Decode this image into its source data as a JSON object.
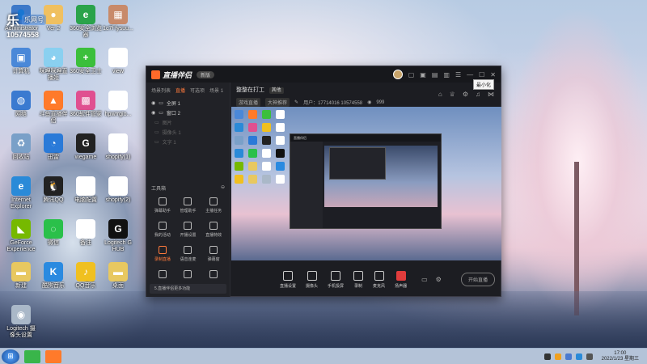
{
  "desktop": {
    "overlay": {
      "brand": "乐",
      "label": "乐网号",
      "number": "10574558"
    },
    "icons": [
      {
        "label": "Administrator",
        "color": "#3c78c8",
        "glyph": "👤"
      },
      {
        "label": "Ver 2",
        "color": "#f0c060",
        "glyph": "●"
      },
      {
        "label": "360安全浏览器",
        "color": "#2aa34a",
        "glyph": "e"
      },
      {
        "label": "1c7f fysuu...",
        "color": "#c88a6a",
        "glyph": "▦"
      },
      {
        "label": "计算机",
        "color": "#4a88d8",
        "glyph": "▣"
      },
      {
        "label": "咪哩咪哩直播姬",
        "color": "#8ad0f0",
        "glyph": "◕"
      },
      {
        "label": "360安全卫士",
        "color": "#3bbf3b",
        "glyph": "+"
      },
      {
        "label": "view",
        "color": "#ffffff",
        "glyph": ""
      },
      {
        "label": "网络",
        "color": "#3a7ad0",
        "glyph": "◍"
      },
      {
        "label": "斗鱼直播伴侣",
        "color": "#ff7a2a",
        "glyph": "▲"
      },
      {
        "label": "360软件管家",
        "color": "#e05090",
        "glyph": "▩"
      },
      {
        "label": "hpwrrgio...",
        "color": "#ffffff",
        "glyph": ""
      },
      {
        "label": "回收站",
        "color": "#7aa0c8",
        "glyph": "♻"
      },
      {
        "label": "迅雷",
        "color": "#2a7ad8",
        "glyph": "◔"
      },
      {
        "label": "wegame",
        "color": "#222222",
        "glyph": "G"
      },
      {
        "label": "shopify(1)",
        "color": "#ffffff",
        "glyph": ""
      },
      {
        "label": "Internet Explorer",
        "color": "#2a8ad8",
        "glyph": "e"
      },
      {
        "label": "腾讯QQ",
        "color": "#222222",
        "glyph": "🐧"
      },
      {
        "label": "电脑配置",
        "color": "#ffffff",
        "glyph": ""
      },
      {
        "label": "shopify(2)",
        "color": "#ffffff",
        "glyph": ""
      },
      {
        "label": "GeForce Experience",
        "color": "#76b900",
        "glyph": "◣"
      },
      {
        "label": "微信",
        "color": "#2ac04a",
        "glyph": "◌"
      },
      {
        "label": "备注",
        "color": "#ffffff",
        "glyph": ""
      },
      {
        "label": "Logitech G HUB",
        "color": "#111111",
        "glyph": "G"
      },
      {
        "label": "新建",
        "color": "#e8c860",
        "glyph": "▬"
      },
      {
        "label": "酷狗音乐",
        "color": "#2a8ae0",
        "glyph": "K"
      },
      {
        "label": "QQ音乐",
        "color": "#f0c020",
        "glyph": "♪"
      },
      {
        "label": "桌面",
        "color": "#e8c860",
        "glyph": "▬"
      },
      {
        "label": "Logitech 摄像头设置",
        "color": "#aab8c8",
        "glyph": "◉"
      }
    ]
  },
  "app": {
    "title": "直播伴侣",
    "badge": "新版",
    "tooltip": "最小化",
    "side_tabs": [
      "场景列表",
      "直播",
      "可选项",
      "场景 1"
    ],
    "layers": [
      {
        "name": "全屏 1",
        "active": true
      },
      {
        "name": "窗口 2",
        "active": true
      },
      {
        "name": "图片",
        "active": false
      },
      {
        "name": "摄像头 1",
        "active": false
      },
      {
        "name": "文字 1",
        "active": false
      }
    ],
    "tools_header": "工具箱",
    "tools": [
      "弹幕助手",
      "管理助手",
      "主播任务",
      "我的活动",
      "开播设置",
      "直播特效",
      "录制直播",
      "语音连麦",
      "弹幕窗",
      "",
      "",
      ""
    ],
    "side_footer": "5.直播伴侣更多功能",
    "stream_title": "整整在打工",
    "stream_category": "其他",
    "room_tags": [
      "游戏直播",
      "大神推荐"
    ],
    "user_info": "用户：17714016 10574558",
    "viewer_count": "999",
    "controls": [
      "直播设置",
      "摄像头",
      "手机投屏",
      "录制",
      "麦克风",
      "扬声器"
    ],
    "live_button": "开始直播"
  },
  "taskbar": {
    "start_glyph": "⊞",
    "apps": [
      {
        "color": "#39b54a"
      },
      {
        "color": "#ff7a2a"
      }
    ],
    "time": "17:00",
    "date": "2022/1/23 星期三"
  }
}
